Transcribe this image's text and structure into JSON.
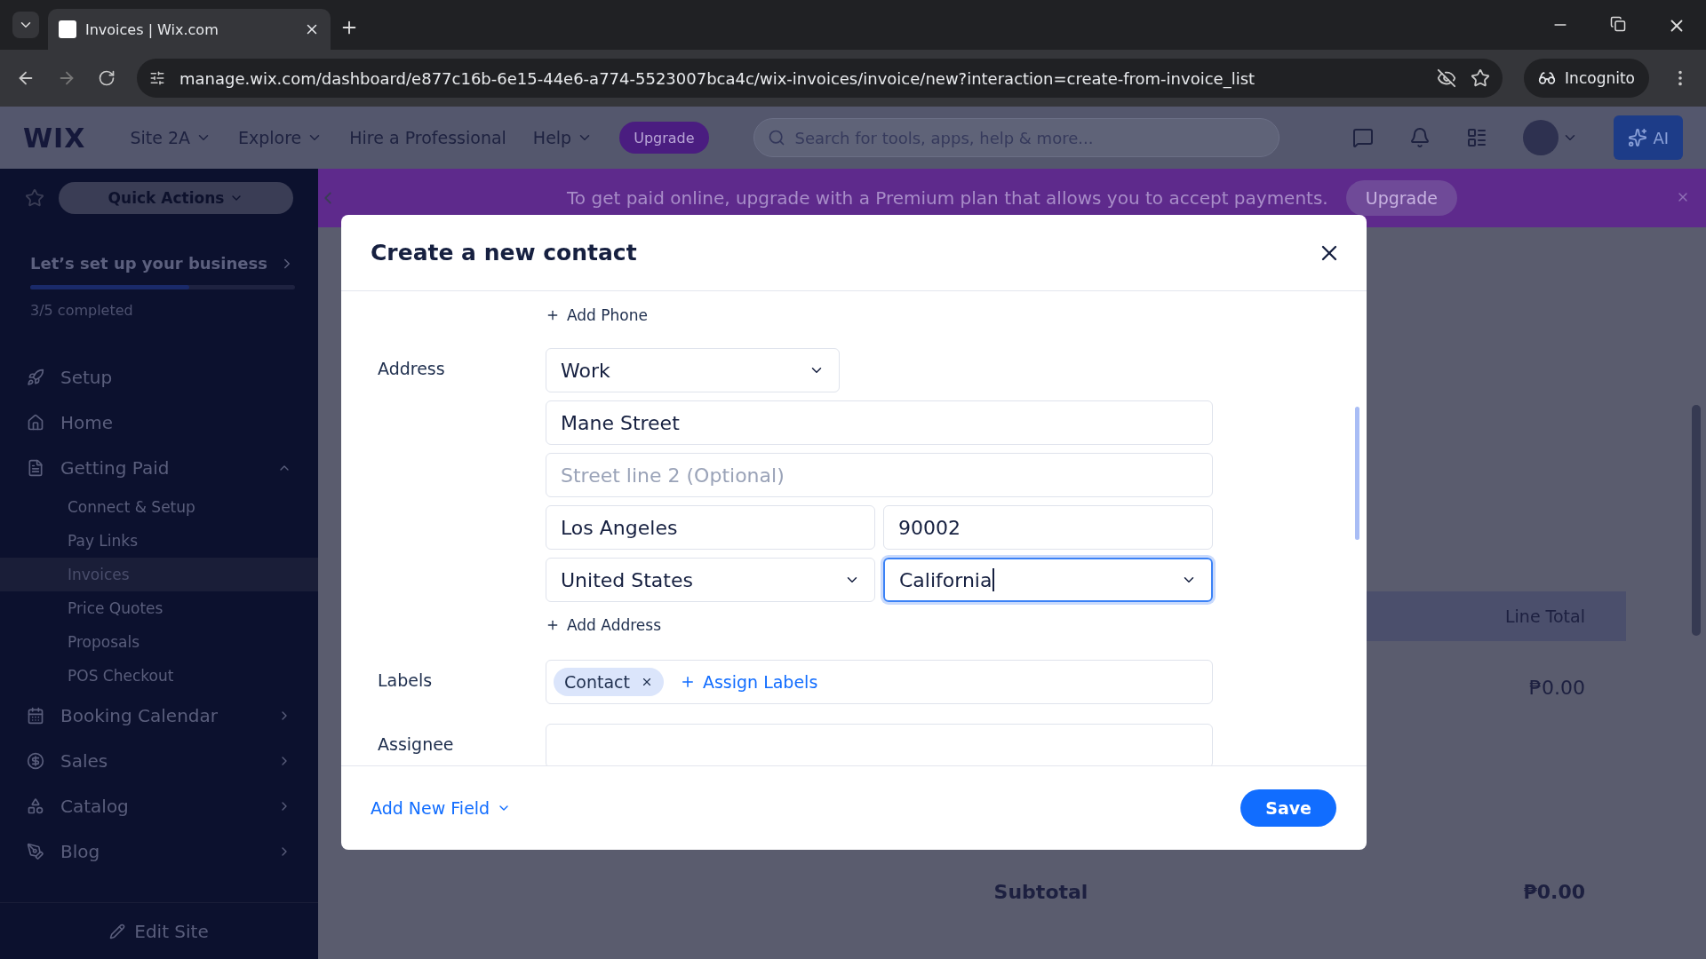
{
  "browser": {
    "tab_title": "Invoices | Wix.com",
    "url": "manage.wix.com/dashboard/e877c16b-6e15-44e6-a774-5523007bca4c/wix-invoices/invoice/new?interaction=create-from-invoice_list",
    "profile": "Incognito"
  },
  "wix_header": {
    "logo": "WIX",
    "site": "Site 2A",
    "nav": [
      "Explore",
      "Hire a Professional",
      "Help"
    ],
    "upgrade": "Upgrade",
    "search": {
      "placeholder": "Search for tools, apps, help & more..."
    },
    "ai": "AI"
  },
  "banner": {
    "text": "To get paid online, upgrade with a Premium plan that allows you to accept payments.",
    "button": "Upgrade"
  },
  "sidebar": {
    "quick_actions": "Quick Actions",
    "setup": {
      "title": "Let’s set up your business",
      "level": 0.6,
      "progress": "3/5 completed"
    },
    "items": [
      {
        "kind": "link",
        "label": "Setup"
      },
      {
        "kind": "link",
        "label": "Home"
      },
      {
        "kind": "group",
        "label": "Getting Paid",
        "expanded": true,
        "children": [
          {
            "label": "Connect & Setup",
            "selected": false
          },
          {
            "label": "Pay Links",
            "selected": false
          },
          {
            "label": "Invoices",
            "selected": true
          },
          {
            "label": "Price Quotes",
            "selected": false
          },
          {
            "label": "Proposals",
            "selected": false
          },
          {
            "label": "POS Checkout",
            "selected": false
          }
        ]
      },
      {
        "kind": "group",
        "label": "Booking Calendar",
        "expanded": false
      },
      {
        "kind": "group",
        "label": "Sales",
        "expanded": false
      },
      {
        "kind": "group",
        "label": "Catalog",
        "expanded": false
      },
      {
        "kind": "group",
        "label": "Blog",
        "expanded": false
      }
    ],
    "edit_site": "Edit Site"
  },
  "page": {
    "line_total_header": "Line Total",
    "line_total": "₱0.00",
    "subtotal_label": "Subtotal",
    "subtotal": "₱0.00"
  },
  "modal": {
    "title": "Create a new contact",
    "add_phone": "Add Phone",
    "address_label": "Address",
    "address_type": "Work",
    "street": "Mane Street",
    "street2": {
      "placeholder": "Street line 2 (Optional)"
    },
    "city": "Los Angeles",
    "zip": "90002",
    "country": "United States",
    "state": {
      "value": "California",
      "focused": true
    },
    "add_address": "Add Address",
    "labels_label": "Labels",
    "chips": [
      "Contact"
    ],
    "assign_labels": "Assign Labels",
    "assignee_label": "Assignee",
    "add_new_field": "Add New Field",
    "save": "Save"
  }
}
